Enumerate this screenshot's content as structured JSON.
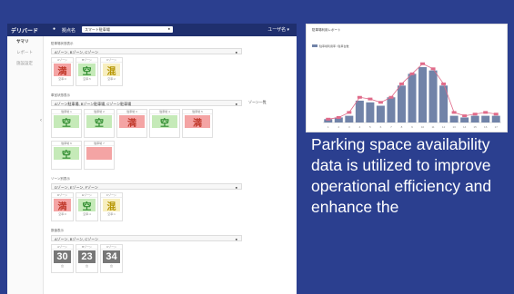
{
  "app": {
    "logo": "デリバード",
    "location_label": "拠点名",
    "location_value": "スマート駐車場",
    "user": "ユーザ名 ▾"
  },
  "sidebar": {
    "items": [
      {
        "label": "サマリ"
      },
      {
        "label": "レポート"
      },
      {
        "label": "施設設定"
      }
    ]
  },
  "sections": [
    {
      "title": "駐車場状態表示",
      "select": "Aゾーン, Bゾーン, Cゾーン",
      "extra": "",
      "cards": [
        {
          "head": "Aゾーン",
          "status": "満",
          "kind": "full",
          "foot": "空車:0"
        },
        {
          "head": "Bゾーン",
          "status": "空",
          "kind": "empty",
          "foot": "空車:5"
        },
        {
          "head": "Cゾーン",
          "status": "混",
          "kind": "busy",
          "foot": "空車:2"
        }
      ]
    },
    {
      "title": "車室状態表示",
      "select": "Aゾーン駐車場, Bゾーン駐車場, Cゾーン駐車場",
      "extra": "ゾーン一覧",
      "cards": [
        {
          "head": "駐車場 1",
          "status": "空",
          "kind": "empty",
          "foot": ""
        },
        {
          "head": "駐車場 2",
          "status": "空",
          "kind": "empty",
          "foot": ""
        },
        {
          "head": "駐車場 3",
          "status": "満",
          "kind": "full",
          "foot": ""
        },
        {
          "head": "駐車場 4",
          "status": "空",
          "kind": "empty",
          "foot": ""
        },
        {
          "head": "駐車場 5",
          "status": "満",
          "kind": "full",
          "foot": ""
        }
      ],
      "cards2": [
        {
          "head": "駐車場 6",
          "status": "空",
          "kind": "empty",
          "foot": ""
        },
        {
          "head": "駐車場 7",
          "status": "",
          "kind": "full",
          "foot": ""
        }
      ]
    },
    {
      "title": "ゾーン別表示",
      "select": "Dゾーン, Eゾーン, Fゾーン",
      "extra": "",
      "cards": [
        {
          "head": "Dゾーン",
          "status": "満",
          "kind": "full",
          "foot": "空車:0"
        },
        {
          "head": "Eゾーン",
          "status": "空",
          "kind": "empty",
          "foot": "空車:4"
        },
        {
          "head": "Fゾーン",
          "status": "混",
          "kind": "busy",
          "foot": "空車:1"
        }
      ]
    },
    {
      "title": "数値表示",
      "select": "Aゾーン, Bゾーン, Cゾーン",
      "extra": "",
      "cards": [
        {
          "head": "Aゾーン",
          "status": "30",
          "kind": "num",
          "foot": "台"
        },
        {
          "head": "Bゾーン",
          "status": "23",
          "kind": "num",
          "foot": "台"
        },
        {
          "head": "Cゾーン",
          "status": "34",
          "kind": "num",
          "foot": "台"
        }
      ]
    }
  ],
  "chart_window": {
    "title": "駐車場利用レポート",
    "legend": "駐車場利用率 / 駐車台数"
  },
  "caption": "Parking space availability data is utilized to improve operational efficiency and enhance the",
  "colors": {
    "background": "#2b3f8f",
    "bar": "#7183a8",
    "line": "#e06b8a"
  },
  "chart_data": {
    "type": "bar",
    "categories": [
      "1",
      "2",
      "3",
      "4",
      "5",
      "6",
      "7",
      "8",
      "9",
      "10",
      "11",
      "12",
      "13",
      "14",
      "15",
      "16",
      "17"
    ],
    "series": [
      {
        "type": "bar",
        "values": [
          4,
          6,
          8,
          26,
          24,
          20,
          30,
          44,
          58,
          66,
          62,
          44,
          8,
          6,
          8,
          8,
          8
        ]
      },
      {
        "type": "line",
        "values": [
          4,
          6,
          12,
          30,
          28,
          24,
          30,
          46,
          58,
          70,
          64,
          46,
          12,
          8,
          10,
          12,
          10
        ]
      }
    ],
    "ylim": [
      0,
      80
    ]
  }
}
